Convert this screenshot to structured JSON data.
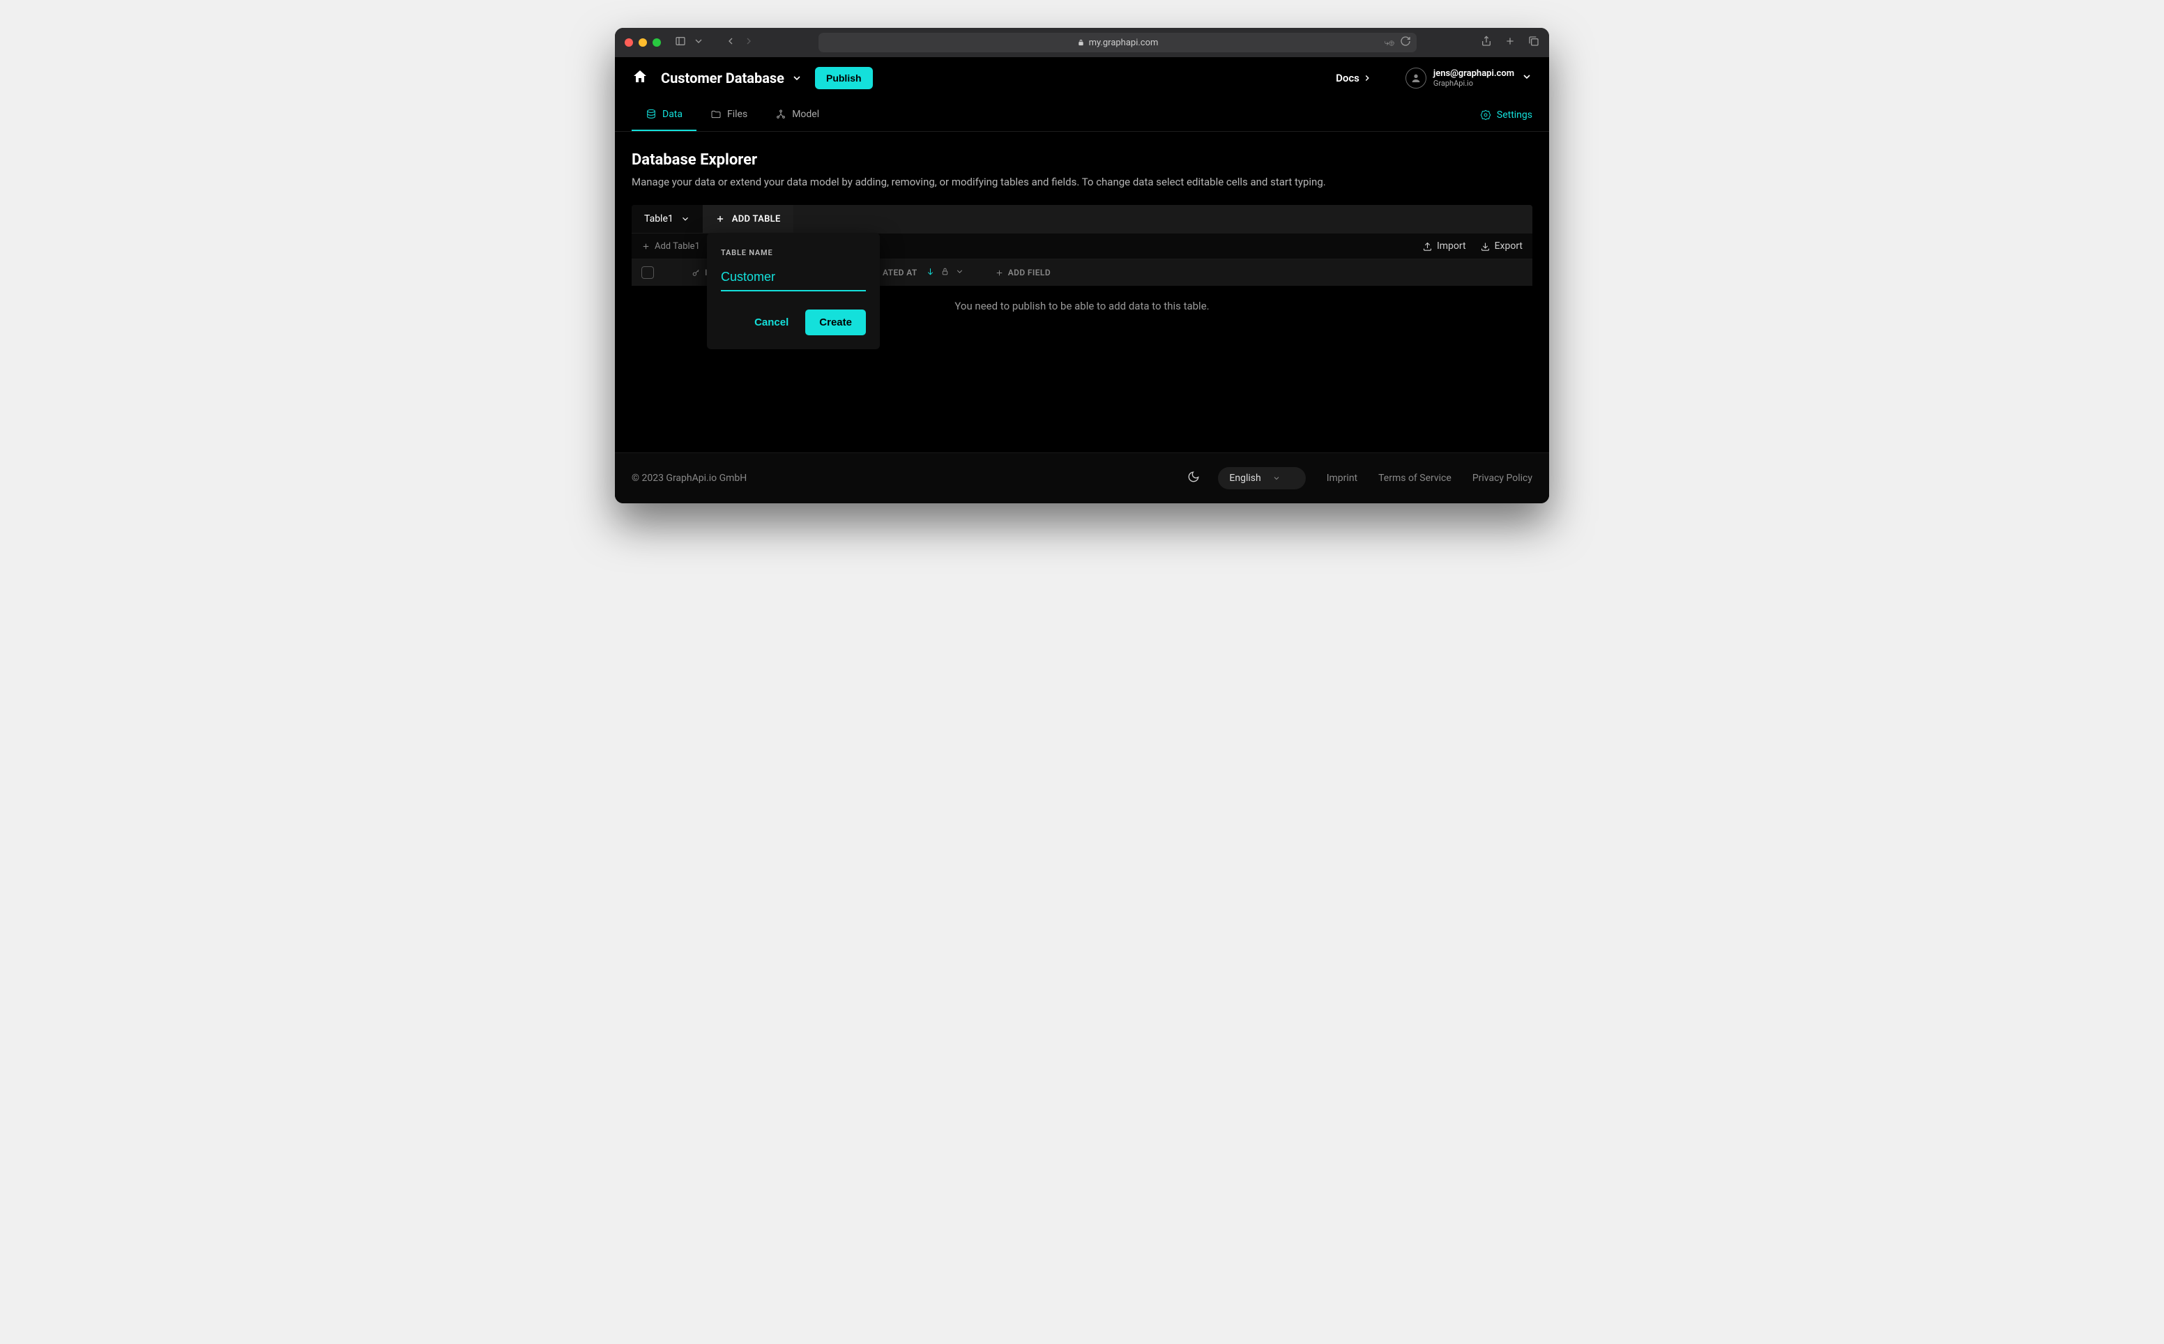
{
  "browser": {
    "url": "my.graphapi.com"
  },
  "header": {
    "db_name": "Customer Database",
    "publish_label": "Publish",
    "docs_label": "Docs",
    "user_email": "jens@graphapi.com",
    "user_org": "GraphApi.io"
  },
  "tabs": {
    "data": "Data",
    "files": "Files",
    "model": "Model",
    "settings": "Settings"
  },
  "page": {
    "title": "Database Explorer",
    "subtitle": "Manage your data or extend your data model by adding, removing, or modifying tables and fields. To change data select editable cells and start typing."
  },
  "tableStrip": {
    "current": "Table1",
    "add_label": "ADD TABLE"
  },
  "toolbar": {
    "add_item": "Add Table1",
    "import": "Import",
    "export": "Export"
  },
  "columns": {
    "id": "ID",
    "updated": "ATED AT",
    "add_field": "ADD FIELD"
  },
  "empty_message": "You need to publish to be able to add data to this table.",
  "popover": {
    "label": "TABLE NAME",
    "value": "Customer",
    "cancel": "Cancel",
    "create": "Create"
  },
  "footer": {
    "copyright": "© 2023 GraphApi.io GmbH",
    "language": "English",
    "imprint": "Imprint",
    "terms": "Terms of Service",
    "privacy": "Privacy Policy"
  }
}
